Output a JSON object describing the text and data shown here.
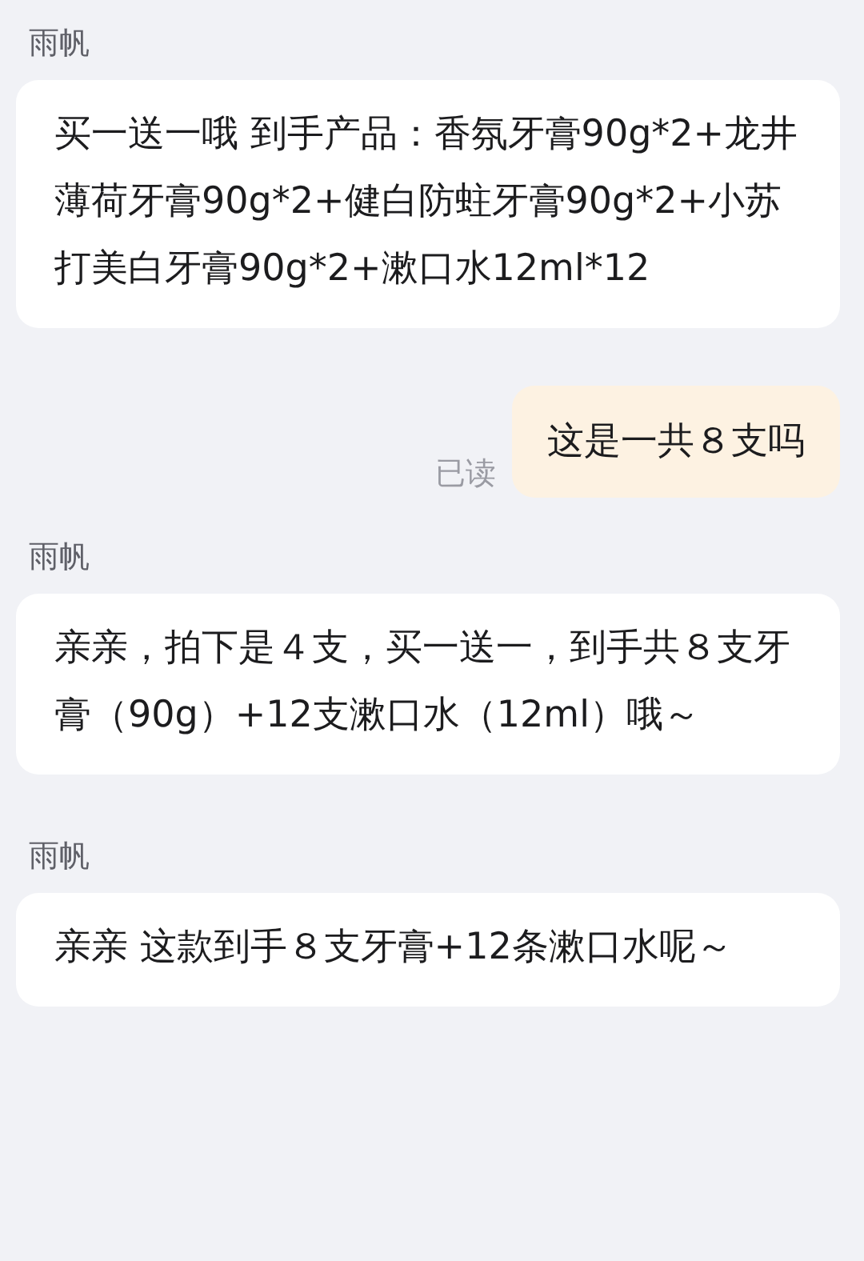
{
  "messages": [
    {
      "kind": "received",
      "sender": "雨帆",
      "text": "买一送一哦 到手产品：香氛牙膏90g*2+龙井薄荷牙膏90g*2+健白防蛀牙膏90g*2+小苏打美白牙膏90g*2+漱口水12ml*12"
    },
    {
      "kind": "sent",
      "status": "已读",
      "text": "这是一共８支吗"
    },
    {
      "kind": "received",
      "sender": "雨帆",
      "text": "亲亲，拍下是４支，买一送一，到手共８支牙膏（90g）+12支漱口水（12ml）哦～"
    },
    {
      "kind": "received",
      "sender": "雨帆",
      "text": "亲亲  这款到手８支牙膏+12条漱口水呢～"
    }
  ]
}
